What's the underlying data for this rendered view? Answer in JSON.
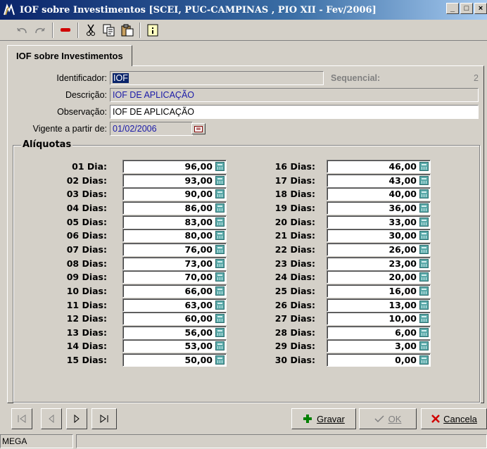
{
  "window": {
    "title": "IOF sobre Investimentos [SCEI, PUC-CAMPINAS , PIO XII - Fev/2006]",
    "app_icon_text": "MEGA"
  },
  "titlebar_buttons": {
    "minimize": "_",
    "maximize": "□",
    "close": "×"
  },
  "toolbar": [
    "undo-icon",
    "redo-icon",
    "delete-icon",
    "cut-icon",
    "copy-icon",
    "paste-icon",
    "info-icon"
  ],
  "tab": {
    "label": "IOF sobre Investimentos"
  },
  "form": {
    "identificador_label": "Identificador:",
    "identificador_value": "IOF",
    "sequencial_label": "Sequencial:",
    "sequencial_value": "2",
    "descricao_label": "Descrição:",
    "descricao_value": "IOF DE APLICAÇÃO",
    "observacao_label": "Observação:",
    "observacao_value": "IOF DE APLICAÇÃO",
    "vigente_label": "Vigente a partir de:",
    "vigente_value": "01/02/2006"
  },
  "aliquotas": {
    "title": "Alíquotas",
    "rows": [
      {
        "label": "01 Dia:",
        "value": "96,00"
      },
      {
        "label": "02 Dias:",
        "value": "93,00"
      },
      {
        "label": "03 Dias:",
        "value": "90,00"
      },
      {
        "label": "04 Dias:",
        "value": "86,00"
      },
      {
        "label": "05 Dias:",
        "value": "83,00"
      },
      {
        "label": "06 Dias:",
        "value": "80,00"
      },
      {
        "label": "07 Dias:",
        "value": "76,00"
      },
      {
        "label": "08 Dias:",
        "value": "73,00"
      },
      {
        "label": "09 Dias:",
        "value": "70,00"
      },
      {
        "label": "10 Dias:",
        "value": "66,00"
      },
      {
        "label": "11 Dias:",
        "value": "63,00"
      },
      {
        "label": "12 Dias:",
        "value": "60,00"
      },
      {
        "label": "13 Dias:",
        "value": "56,00"
      },
      {
        "label": "14 Dias:",
        "value": "53,00"
      },
      {
        "label": "15 Dias:",
        "value": "50,00"
      },
      {
        "label": "16 Dias:",
        "value": "46,00"
      },
      {
        "label": "17 Dias:",
        "value": "43,00"
      },
      {
        "label": "18 Dias:",
        "value": "40,00"
      },
      {
        "label": "19 Dias:",
        "value": "36,00"
      },
      {
        "label": "20 Dias:",
        "value": "33,00"
      },
      {
        "label": "21 Dias:",
        "value": "30,00"
      },
      {
        "label": "22 Dias:",
        "value": "26,00"
      },
      {
        "label": "23 Dias:",
        "value": "23,00"
      },
      {
        "label": "24 Dias:",
        "value": "20,00"
      },
      {
        "label": "25 Dias:",
        "value": "16,00"
      },
      {
        "label": "26 Dias:",
        "value": "13,00"
      },
      {
        "label": "27 Dias:",
        "value": "10,00"
      },
      {
        "label": "28 Dias:",
        "value": "6,00"
      },
      {
        "label": "29 Dias:",
        "value": "3,00"
      },
      {
        "label": "30 Dias:",
        "value": "0,00"
      }
    ]
  },
  "nav": {
    "gravar": "Gravar",
    "ok": "OK",
    "cancela": "Cancela"
  },
  "status": {
    "text": "MEGA"
  },
  "colors": {
    "title_bar": "#0a246a",
    "field_text": "#1a1aa8",
    "face": "#d4d0c8"
  }
}
